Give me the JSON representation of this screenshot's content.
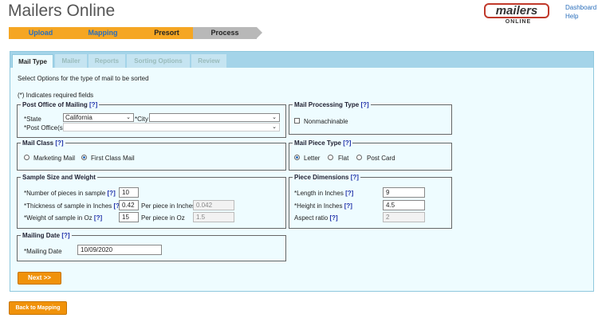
{
  "app": {
    "title": "Mailers Online",
    "logo_text": "mailers",
    "logo_sub": "ONLINE"
  },
  "toplinks": {
    "dashboard": "Dashboard",
    "help": "Help"
  },
  "wizard": {
    "steps": [
      {
        "label": "Upload",
        "color": "#f5a623",
        "text": "#2a6ebb"
      },
      {
        "label": "Mapping",
        "color": "#f5a623",
        "text": "#2a6ebb"
      },
      {
        "label": "Presort",
        "color": "#f5a623",
        "text": "#222"
      },
      {
        "label": "Process",
        "color": "#b8b8b8",
        "text": "#222"
      }
    ]
  },
  "tabs": [
    {
      "label": "Mail Type",
      "active": true
    },
    {
      "label": "Mailer",
      "active": false
    },
    {
      "label": "Reports",
      "active": false
    },
    {
      "label": "Sorting Options",
      "active": false
    },
    {
      "label": "Review",
      "active": false
    }
  ],
  "intro": "Select Options for the type of mail to be sorted",
  "required_note": "(*) Indicates required fields",
  "help_mark": "[?]",
  "post_office": {
    "legend": "Post Office of Mailing",
    "state_label": "*State",
    "state_value": "California",
    "city_label": "*City",
    "city_value": "",
    "po_label": "*Post Office(s)"
  },
  "mail_processing": {
    "legend": "Mail Processing Type",
    "option": "Nonmachinable"
  },
  "mail_class": {
    "legend": "Mail Class",
    "options": [
      "Marketing Mail",
      "First Class Mail"
    ],
    "selected": 1
  },
  "piece_type": {
    "legend": "Mail Piece Type",
    "options": [
      "Letter",
      "Flat",
      "Post Card"
    ],
    "selected": 0
  },
  "sample": {
    "legend": "Sample Size and Weight",
    "pieces_label": "*Number of pieces in sample",
    "pieces_value": "10",
    "thick_label": "*Thickness of sample in Inches",
    "thick_value": "0.42",
    "thick_per_label": "Per piece in Inches",
    "thick_per_value": "0.042",
    "weight_label": "*Weight of sample in Oz",
    "weight_value": "15",
    "weight_per_label": "Per piece in Oz",
    "weight_per_value": "1.5"
  },
  "dimensions": {
    "legend": "Piece Dimensions",
    "length_label": "*Length in Inches",
    "length_value": "9",
    "height_label": "*Height in Inches",
    "height_value": "4.5",
    "aspect_label": "Aspect ratio",
    "aspect_value": "2"
  },
  "mailing_date": {
    "legend": "Mailing Date",
    "label": "*Mailing Date",
    "value": "10/09/2020"
  },
  "buttons": {
    "next": "Next >>",
    "back": "Back to Mapping"
  }
}
